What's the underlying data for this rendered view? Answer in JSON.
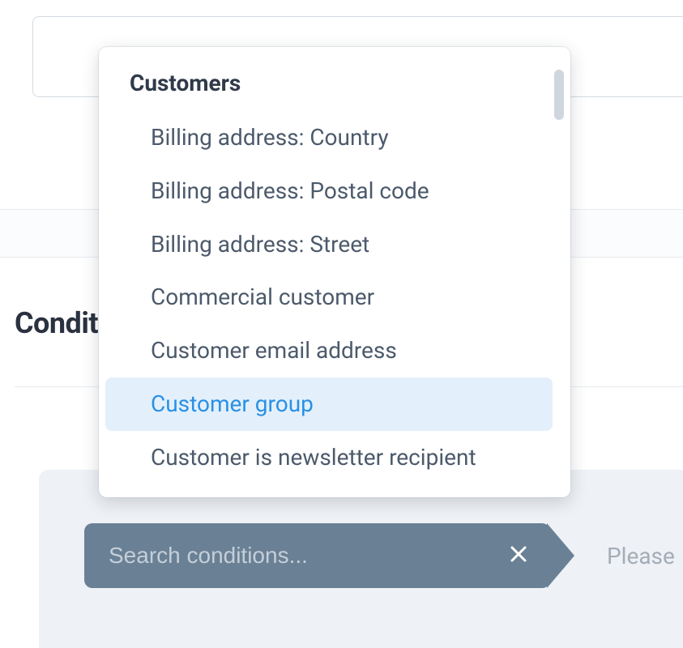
{
  "section": {
    "heading": "Conditions"
  },
  "chip": {
    "search_placeholder": "Search conditions...",
    "next_placeholder": "Please"
  },
  "dropdown": {
    "group_label": "Customers",
    "items": [
      {
        "label": "Billing address: Country",
        "highlight": false
      },
      {
        "label": "Billing address: Postal code",
        "highlight": false
      },
      {
        "label": "Billing address: Street",
        "highlight": false
      },
      {
        "label": "Commercial customer",
        "highlight": false
      },
      {
        "label": "Customer email address",
        "highlight": false
      },
      {
        "label": "Customer group",
        "highlight": true
      },
      {
        "label": "Customer is newsletter recipient",
        "highlight": false
      }
    ]
  }
}
